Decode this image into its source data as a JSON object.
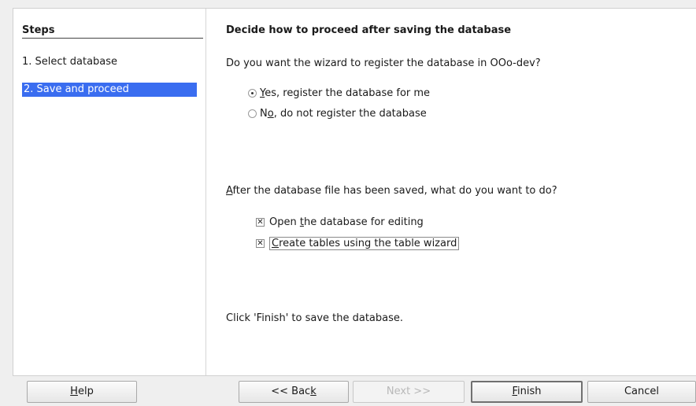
{
  "steps": {
    "heading": "Steps",
    "items": [
      {
        "label": "1. Select database",
        "active": false
      },
      {
        "label": "2. Save and proceed",
        "active": true
      }
    ]
  },
  "content": {
    "title": "Decide how to proceed after saving the database",
    "register_question": "Do you want the wizard to register the database in OOo-dev?",
    "register_options": [
      {
        "key": "Y",
        "rest": "es, register the database for me",
        "checked": true
      },
      {
        "prefix": "N",
        "key": "o",
        "rest": ", do not register the database",
        "checked": false
      }
    ],
    "after_question_key": "A",
    "after_question_rest": "fter the database file has been saved, what do you want to do?",
    "after_options": [
      {
        "prefix": "Open ",
        "key": "t",
        "rest": "he database for editing",
        "checked": true
      },
      {
        "key": "C",
        "rest": "reate tables using the table wizard",
        "checked": true
      }
    ],
    "finish_hint": "Click 'Finish' to save the database."
  },
  "buttons": {
    "help": {
      "key": "H",
      "rest": "elp"
    },
    "back": {
      "prefix": "<< Bac",
      "key": "k"
    },
    "next": "Next >>",
    "finish": {
      "key": "F",
      "rest": "inish"
    },
    "cancel": "Cancel"
  },
  "colors": {
    "selection": "#3a6df0",
    "background": "#efefef"
  }
}
